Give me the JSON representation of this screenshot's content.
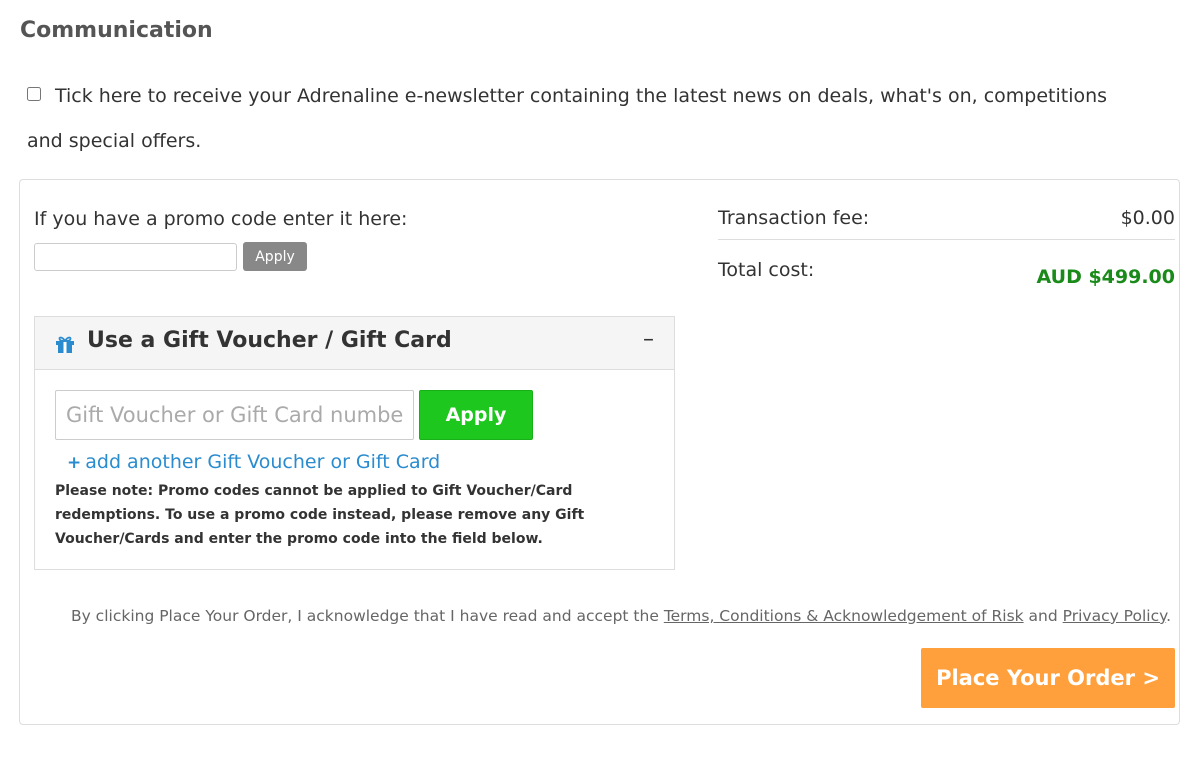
{
  "communication": {
    "title": "Communication",
    "newsletter_label": "Tick here to receive your Adrenaline e-newsletter containing the latest news on deals, what's on, competitions and special offers.",
    "newsletter_checked": false
  },
  "promo": {
    "label": "If you have a promo code enter it here:",
    "input_value": "",
    "apply_label": "Apply"
  },
  "gift_voucher": {
    "title": "Use a Gift Voucher / Gift Card",
    "toggle_label": "–",
    "input_placeholder": "Gift Voucher or Gift Card number",
    "apply_label": "Apply",
    "add_another_plus": "+",
    "add_another_label": "add another Gift Voucher or Gift Card",
    "note": "Please note: Promo codes cannot be applied to Gift Voucher/Card redemptions. To use a promo code instead, please remove any Gift Voucher/Cards and enter the promo code into the field below."
  },
  "summary": {
    "fee_label": "Transaction fee:",
    "fee_value": "$0.00",
    "total_label": "Total cost:",
    "total_value": "AUD $499.00"
  },
  "legal": {
    "prefix": "By clicking Place Your Order, I acknowledge that I have read and accept the ",
    "terms_link": "Terms, Conditions & Acknowledgement of Risk",
    "middle": " and ",
    "privacy_link": "Privacy Policy",
    "suffix": "."
  },
  "place_order_label": "Place Your Order >",
  "colors": {
    "accent_green": "#1ec71e",
    "total_green": "#1a8a1a",
    "order_orange": "#ffa03c",
    "link_blue": "#2a8ccf",
    "gift_icon_blue": "#2a8ccf"
  },
  "icons": {
    "gift": "gift-icon"
  }
}
